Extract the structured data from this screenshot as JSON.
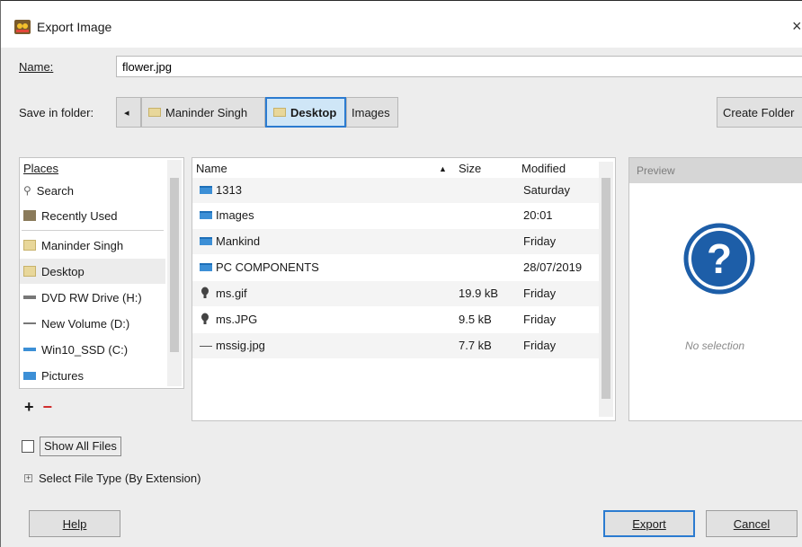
{
  "window": {
    "title": "Export Image",
    "close": "×"
  },
  "name_label": "Name:",
  "name_value": "flower.jpg",
  "save_in_label": "Save in folder:",
  "path": {
    "back": "◂",
    "crumbs": [
      "Maninder Singh",
      "Desktop",
      "Images"
    ]
  },
  "create_folder": "Create Folder",
  "places": {
    "header": "Places",
    "items": [
      {
        "label": "Search",
        "icon": "search-icon"
      },
      {
        "label": "Recently Used",
        "icon": "recent-icon"
      },
      {
        "label": "Maninder Singh",
        "icon": "folder-icon"
      },
      {
        "label": "Desktop",
        "icon": "folder-icon"
      },
      {
        "label": "DVD RW Drive (H:)",
        "icon": "optical-drive-icon"
      },
      {
        "label": "New Volume (D:)",
        "icon": "drive-icon"
      },
      {
        "label": "Win10_SSD (C:)",
        "icon": "drive-icon"
      },
      {
        "label": "Pictures",
        "icon": "pictures-folder-icon"
      }
    ],
    "add": "+",
    "remove": "−"
  },
  "files": {
    "headers": {
      "name": "Name",
      "sort": "▲",
      "size": "Size",
      "modified": "Modified"
    },
    "rows": [
      {
        "name": "1313",
        "size": "",
        "modified": "Saturday",
        "icon": "folder-icon"
      },
      {
        "name": "Images",
        "size": "",
        "modified": "20:01",
        "icon": "folder-icon"
      },
      {
        "name": "Mankind",
        "size": "",
        "modified": "Friday",
        "icon": "folder-icon"
      },
      {
        "name": "PC COMPONENTS",
        "size": "",
        "modified": "28/07/2019",
        "icon": "folder-icon"
      },
      {
        "name": "ms.gif",
        "size": "19.9 kB",
        "modified": "Friday",
        "icon": "image-file-icon"
      },
      {
        "name": "ms.JPG",
        "size": "9.5 kB",
        "modified": "Friday",
        "icon": "image-file-icon"
      },
      {
        "name": "mssig.jpg",
        "size": "7.7 kB",
        "modified": "Friday",
        "icon": "file-icon"
      }
    ]
  },
  "preview": {
    "header": "Preview",
    "empty": "No selection"
  },
  "show_all_files": "Show All Files",
  "select_file_type": "Select File Type (By Extension)",
  "buttons": {
    "help": "Help",
    "export": "Export",
    "cancel": "Cancel"
  },
  "colors": {
    "accent": "#2b7bd0",
    "folder": "#3c8fd6",
    "remove": "#d02b2b"
  }
}
